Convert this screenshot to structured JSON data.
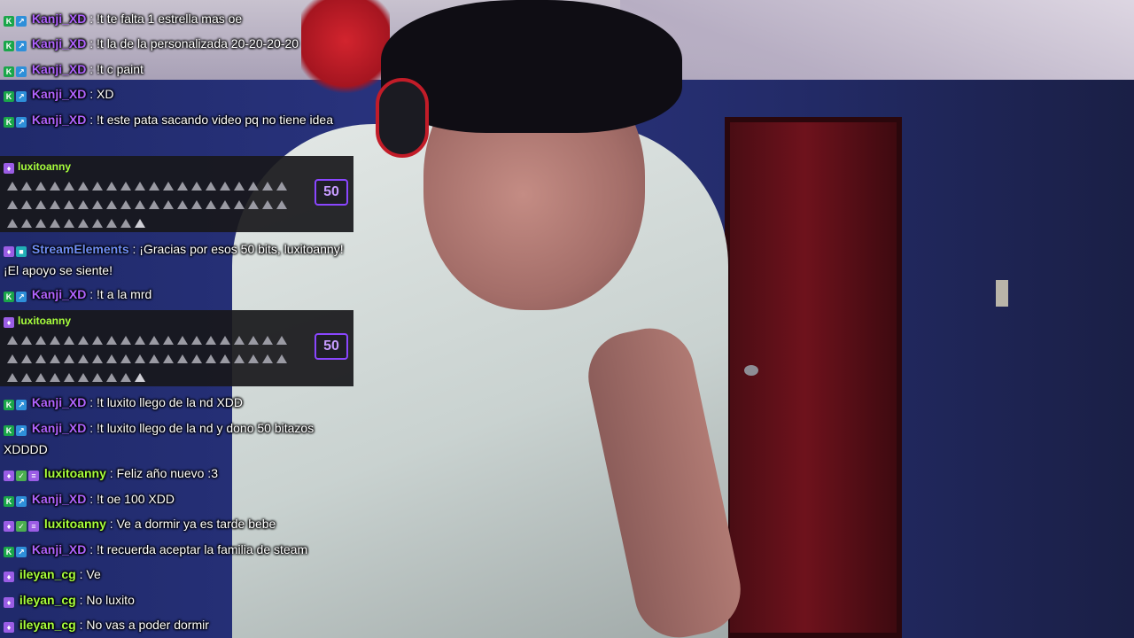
{
  "messages": [
    {
      "user": "Kanji_XD",
      "text": ": !t te falta 1 estrella mas oe"
    },
    {
      "user": "Kanji_XD",
      "text": ": !t la de la personalizada 20-20-20-20"
    },
    {
      "user": "Kanji_XD",
      "text": ": !t c paint"
    },
    {
      "user": "Kanji_XD",
      "text": ": XD"
    },
    {
      "user": "Kanji_XD",
      "text": ": !t este pata sacando video pq no tiene idea"
    },
    {
      "user": "StreamElements",
      "text": ": ¡Gracias por esos 50 bits, luxitoanny! ¡El apoyo se siente!"
    },
    {
      "user": "Kanji_XD",
      "text": ": !t a la mrd"
    },
    {
      "user": "Kanji_XD",
      "text": ": !t luxito llego de la nd XDD"
    },
    {
      "user": "Kanji_XD",
      "text": ": !t luxito llego de la nd y dono 50 bitazos XDDDD"
    },
    {
      "user": "luxitoanny",
      "text": ": Feliz año nuevo :3"
    },
    {
      "user": "Kanji_XD",
      "text": ": !t oe 100 XDD"
    },
    {
      "user": "luxitoanny",
      "text": ": Ve a dormir ya es tarde bebe"
    },
    {
      "user": "Kanji_XD",
      "text": ": !t recuerda aceptar la familia de steam"
    },
    {
      "user": "ileyan_cg",
      "text": ": Ve"
    },
    {
      "user": "ileyan_cg",
      "text": ": No luxito"
    },
    {
      "user": "ileyan_cg",
      "text": ": No vas a poder dormir"
    }
  ],
  "cheers": [
    {
      "user": "luxitoanny",
      "amount": "50"
    },
    {
      "user": "luxitoanny",
      "amount": "50"
    }
  ],
  "colors": {
    "kanji": "#b063ff",
    "streamelements": "#6f8ef5",
    "luxitoanny": "#a8ff3c",
    "ileyan": "#a8ff3c",
    "cheer_border": "#8a46ff"
  }
}
